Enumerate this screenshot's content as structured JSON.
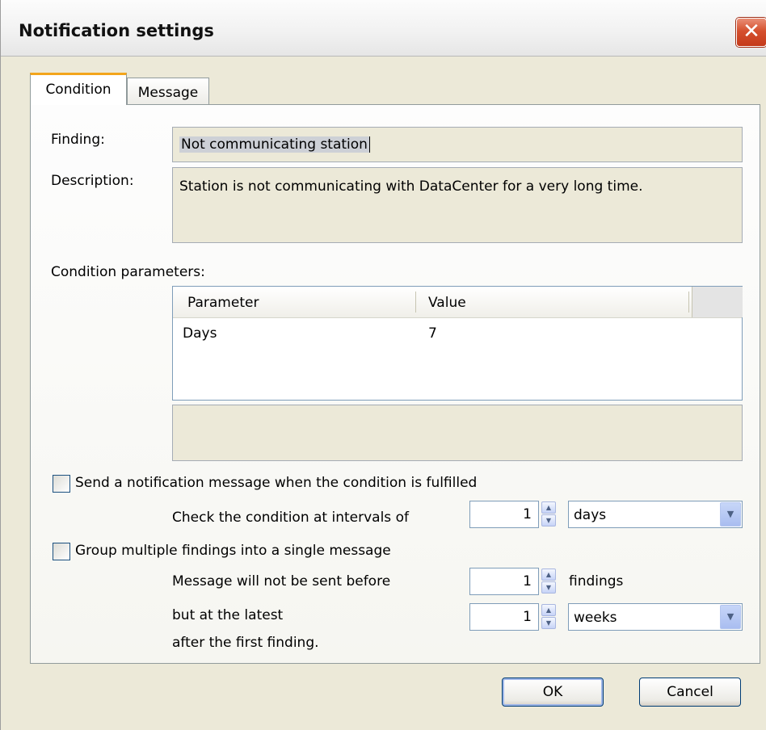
{
  "window": {
    "title": "Notification settings",
    "close_glyph": "✕"
  },
  "tabs": [
    {
      "label": "Condition",
      "active": true
    },
    {
      "label": "Message",
      "active": false
    }
  ],
  "condition": {
    "finding_label": "Finding:",
    "finding_value": "Not communicating station",
    "description_label": "Description:",
    "description_value": "Station is not communicating with DataCenter for a very long time.",
    "params_label": "Condition parameters:",
    "table": {
      "columns": [
        "Parameter",
        "Value"
      ],
      "rows": [
        {
          "parameter": "Days",
          "value": "7"
        }
      ]
    }
  },
  "notify": {
    "send_checkbox_label": "Send a notification message when the condition is fulfilled",
    "send_checked": false,
    "interval_label": "Check the condition at intervals of",
    "interval_value": "1",
    "interval_unit": "days",
    "group_checkbox_label": "Group multiple findings into a single message",
    "group_checked": false,
    "not_before_label": "Message will not be sent before",
    "not_before_value": "1",
    "not_before_unit": "findings",
    "latest_label": "but at the latest",
    "latest_value": "1",
    "latest_unit": "weeks",
    "after_first_label": "after the first finding."
  },
  "buttons": {
    "ok": "OK",
    "cancel": "Cancel"
  },
  "colors": {
    "accent_tab": "#f3a51b",
    "close_button": "#d5502e",
    "window_bg": "#ece9d8"
  },
  "icons": {
    "spin_up": "▲",
    "spin_down": "▼",
    "dropdown": "▼"
  }
}
